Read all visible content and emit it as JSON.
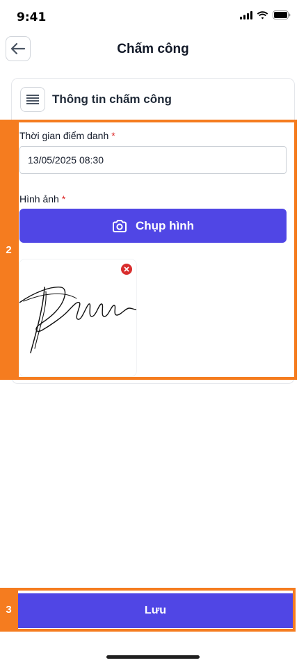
{
  "status_bar": {
    "time": "9:41"
  },
  "header": {
    "title": "Chấm công"
  },
  "card": {
    "title": "Thông tin chấm công",
    "time_field": {
      "label": "Thời gian điểm danh",
      "required_mark": "*",
      "value": "13/05/2025 08:30"
    },
    "image_field": {
      "label": "Hình ảnh",
      "required_mark": "*",
      "capture_label": "Chụp hình"
    }
  },
  "footer": {
    "save_label": "Lưu"
  },
  "annotations": {
    "region_2": "2",
    "region_3": "3"
  },
  "colors": {
    "primary": "#5046e5",
    "highlight": "#f57c1f",
    "required": "#dc2626",
    "remove": "#d92d2d"
  }
}
